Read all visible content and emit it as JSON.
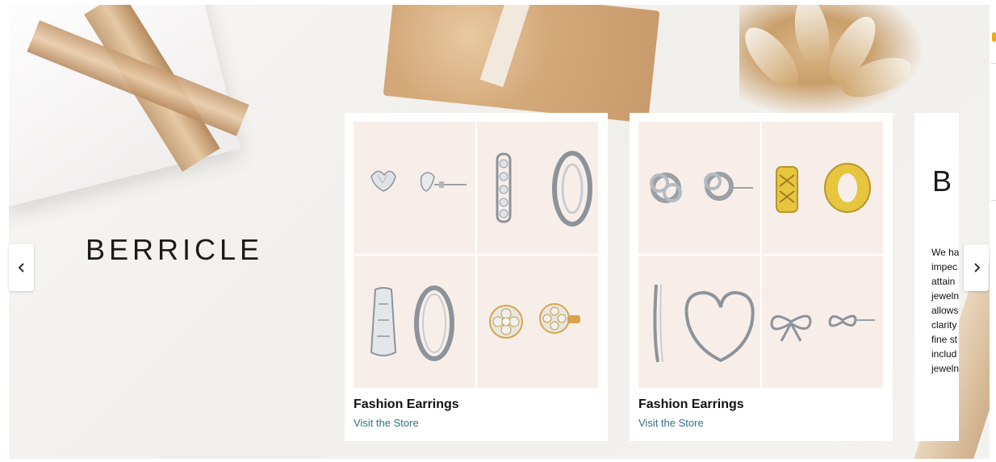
{
  "brand": {
    "name": "BERRICLE"
  },
  "carousel": {
    "prev_icon": "chevron-left-icon",
    "next_icon": "chevron-right-icon"
  },
  "cards": [
    {
      "title": "Fashion Earrings",
      "link": "Visit the Store",
      "tiles": [
        {
          "icon": "cz-heart-stud-earring-image"
        },
        {
          "icon": "cz-hoop-earring-image"
        },
        {
          "icon": "filigree-hoop-earring-image"
        },
        {
          "icon": "gold-flower-stud-earring-image"
        }
      ]
    },
    {
      "title": "Fashion Earrings",
      "link": "Visit the Store",
      "tiles": [
        {
          "icon": "love-knot-stud-earring-image"
        },
        {
          "icon": "gold-filigree-huggie-earring-image"
        },
        {
          "icon": "heart-hoop-earring-image"
        },
        {
          "icon": "bow-stud-earring-image"
        }
      ]
    },
    {
      "logo": "B",
      "text": "We ha\nimpec\nattain\njeweln\nallows\nclarity\nfine st\ninclud\njeweln"
    }
  ],
  "colors": {
    "card_tile_bg": "#f8eee9",
    "link": "#2f6f86",
    "title": "#0f1111"
  }
}
